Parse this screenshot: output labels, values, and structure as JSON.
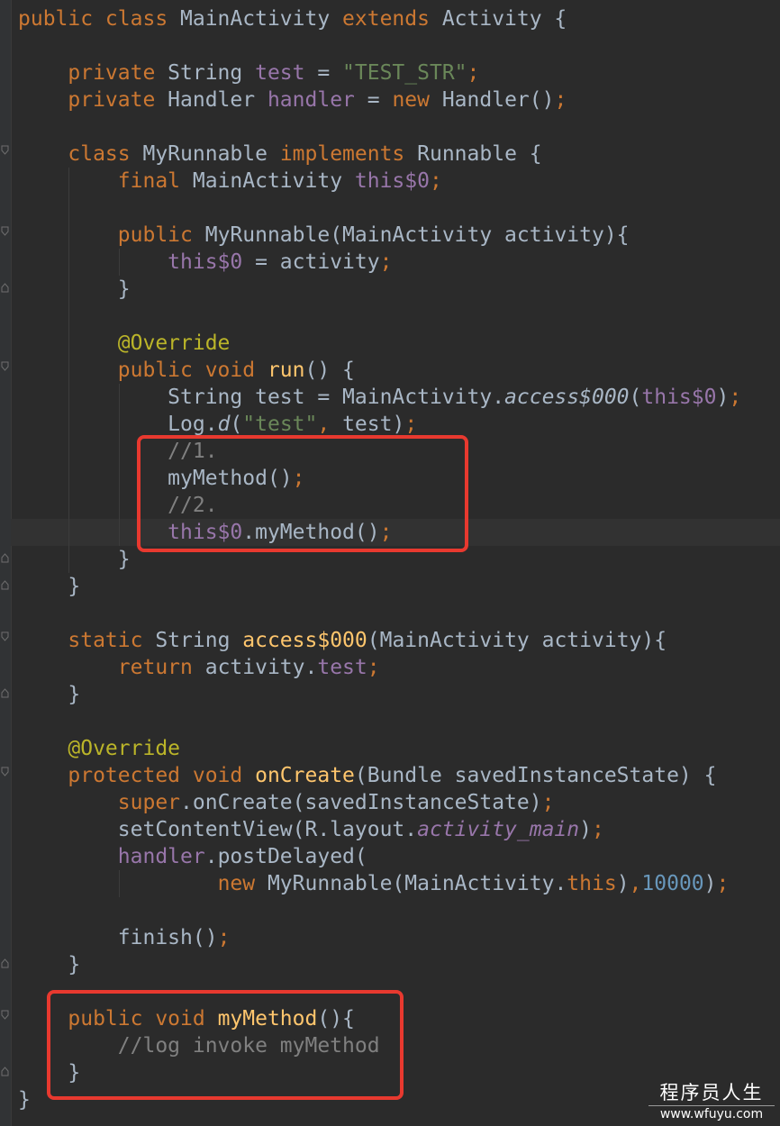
{
  "editor": {
    "colors": {
      "background": "#2b2b2b",
      "keyword": "#cc7832",
      "field": "#9876aa",
      "string": "#6a8759",
      "number": "#6897bb",
      "comment": "#808080",
      "annotation": "#bbb529",
      "method_declaration": "#ffc66d",
      "plain": "#a9b7c6",
      "highlight_box": "#e8392f"
    },
    "lines": [
      [
        [
          "kw",
          "public class "
        ],
        [
          "pl",
          "MainActivity "
        ],
        [
          "kw",
          "extends "
        ],
        [
          "pl",
          "Activity {"
        ]
      ],
      [],
      [
        [
          "pl",
          "    "
        ],
        [
          "kw",
          "private "
        ],
        [
          "pl",
          "String "
        ],
        [
          "fld",
          "test"
        ],
        [
          "pl",
          " = "
        ],
        [
          "str",
          "\"TEST_STR\""
        ],
        [
          "punc",
          ";"
        ]
      ],
      [
        [
          "pl",
          "    "
        ],
        [
          "kw",
          "private "
        ],
        [
          "pl",
          "Handler "
        ],
        [
          "fld",
          "handler"
        ],
        [
          "pl",
          " = "
        ],
        [
          "kw",
          "new "
        ],
        [
          "pl",
          "Handler()"
        ],
        [
          "punc",
          ";"
        ]
      ],
      [],
      [
        [
          "pl",
          "    "
        ],
        [
          "kw",
          "class "
        ],
        [
          "pl",
          "MyRunnable "
        ],
        [
          "kw",
          "implements "
        ],
        [
          "pl",
          "Runnable {"
        ]
      ],
      [
        [
          "pl",
          "        "
        ],
        [
          "kw",
          "final "
        ],
        [
          "pl",
          "MainActivity "
        ],
        [
          "fld",
          "this$0"
        ],
        [
          "punc",
          ";"
        ]
      ],
      [],
      [
        [
          "pl",
          "        "
        ],
        [
          "kw",
          "public "
        ],
        [
          "pl",
          "MyRunnable(MainActivity activity){"
        ]
      ],
      [
        [
          "pl",
          "            "
        ],
        [
          "fld",
          "this$0"
        ],
        [
          "pl",
          " = activity"
        ],
        [
          "punc",
          ";"
        ]
      ],
      [
        [
          "pl",
          "        }"
        ]
      ],
      [],
      [
        [
          "pl",
          "        "
        ],
        [
          "ann",
          "@Override"
        ]
      ],
      [
        [
          "pl",
          "        "
        ],
        [
          "kw",
          "public void "
        ],
        [
          "fn",
          "run"
        ],
        [
          "pl",
          "() {"
        ]
      ],
      [
        [
          "pl",
          "            String test = MainActivity."
        ],
        [
          "it",
          "access$000"
        ],
        [
          "pl",
          "("
        ],
        [
          "fld",
          "this$0"
        ],
        [
          "pl",
          ")"
        ],
        [
          "punc",
          ";"
        ]
      ],
      [
        [
          "pl",
          "            Log."
        ],
        [
          "it",
          "d"
        ],
        [
          "pl",
          "("
        ],
        [
          "str",
          "\"test\""
        ],
        [
          "punc",
          ", "
        ],
        [
          "pl",
          "test)"
        ],
        [
          "punc",
          ";"
        ]
      ],
      [
        [
          "pl",
          "            "
        ],
        [
          "cmt",
          "//1."
        ]
      ],
      [
        [
          "pl",
          "            myMethod()"
        ],
        [
          "punc",
          ";"
        ]
      ],
      [
        [
          "pl",
          "            "
        ],
        [
          "cmt",
          "//2."
        ]
      ],
      [
        [
          "pl",
          "            "
        ],
        [
          "fld",
          "this$0"
        ],
        [
          "pl",
          ".myMethod()"
        ],
        [
          "punc",
          ";"
        ]
      ],
      [
        [
          "pl",
          "        }"
        ]
      ],
      [
        [
          "pl",
          "    }"
        ]
      ],
      [],
      [
        [
          "pl",
          "    "
        ],
        [
          "kw",
          "static "
        ],
        [
          "pl",
          "String "
        ],
        [
          "fn",
          "access$000"
        ],
        [
          "pl",
          "(MainActivity activity){"
        ]
      ],
      [
        [
          "pl",
          "        "
        ],
        [
          "kw",
          "return "
        ],
        [
          "pl",
          "activity."
        ],
        [
          "fld",
          "test"
        ],
        [
          "punc",
          ";"
        ]
      ],
      [
        [
          "pl",
          "    }"
        ]
      ],
      [],
      [
        [
          "pl",
          "    "
        ],
        [
          "ann",
          "@Override"
        ]
      ],
      [
        [
          "pl",
          "    "
        ],
        [
          "kw",
          "protected void "
        ],
        [
          "fn",
          "onCreate"
        ],
        [
          "pl",
          "(Bundle savedInstanceState) {"
        ]
      ],
      [
        [
          "pl",
          "        "
        ],
        [
          "kw",
          "super"
        ],
        [
          "pl",
          ".onCreate(savedInstanceState)"
        ],
        [
          "punc",
          ";"
        ]
      ],
      [
        [
          "pl",
          "        setContentView(R.layout."
        ],
        [
          "fld_it",
          "activity_main"
        ],
        [
          "pl",
          ")"
        ],
        [
          "punc",
          ";"
        ]
      ],
      [
        [
          "pl",
          "        "
        ],
        [
          "fld",
          "handler"
        ],
        [
          "pl",
          ".postDelayed("
        ]
      ],
      [
        [
          "pl",
          "                "
        ],
        [
          "kw",
          "new "
        ],
        [
          "pl",
          "MyRunnable(MainActivity."
        ],
        [
          "kw",
          "this"
        ],
        [
          "pl",
          ")"
        ],
        [
          "punc",
          ","
        ],
        [
          "num",
          "10000"
        ],
        [
          "pl",
          ")"
        ],
        [
          "punc",
          ";"
        ]
      ],
      [],
      [
        [
          "pl",
          "        finish()"
        ],
        [
          "punc",
          ";"
        ]
      ],
      [
        [
          "pl",
          "    }"
        ]
      ],
      [],
      [
        [
          "pl",
          "    "
        ],
        [
          "kw",
          "public void "
        ],
        [
          "fn",
          "myMethod"
        ],
        [
          "pl",
          "(){"
        ]
      ],
      [
        [
          "pl",
          "        "
        ],
        [
          "cmt",
          "//log invoke myMethod"
        ]
      ],
      [
        [
          "pl",
          "    }"
        ]
      ],
      [
        [
          "pl",
          "}"
        ]
      ]
    ]
  },
  "watermark": {
    "title": "程序员人生",
    "url": "www.wfuyu.com"
  }
}
